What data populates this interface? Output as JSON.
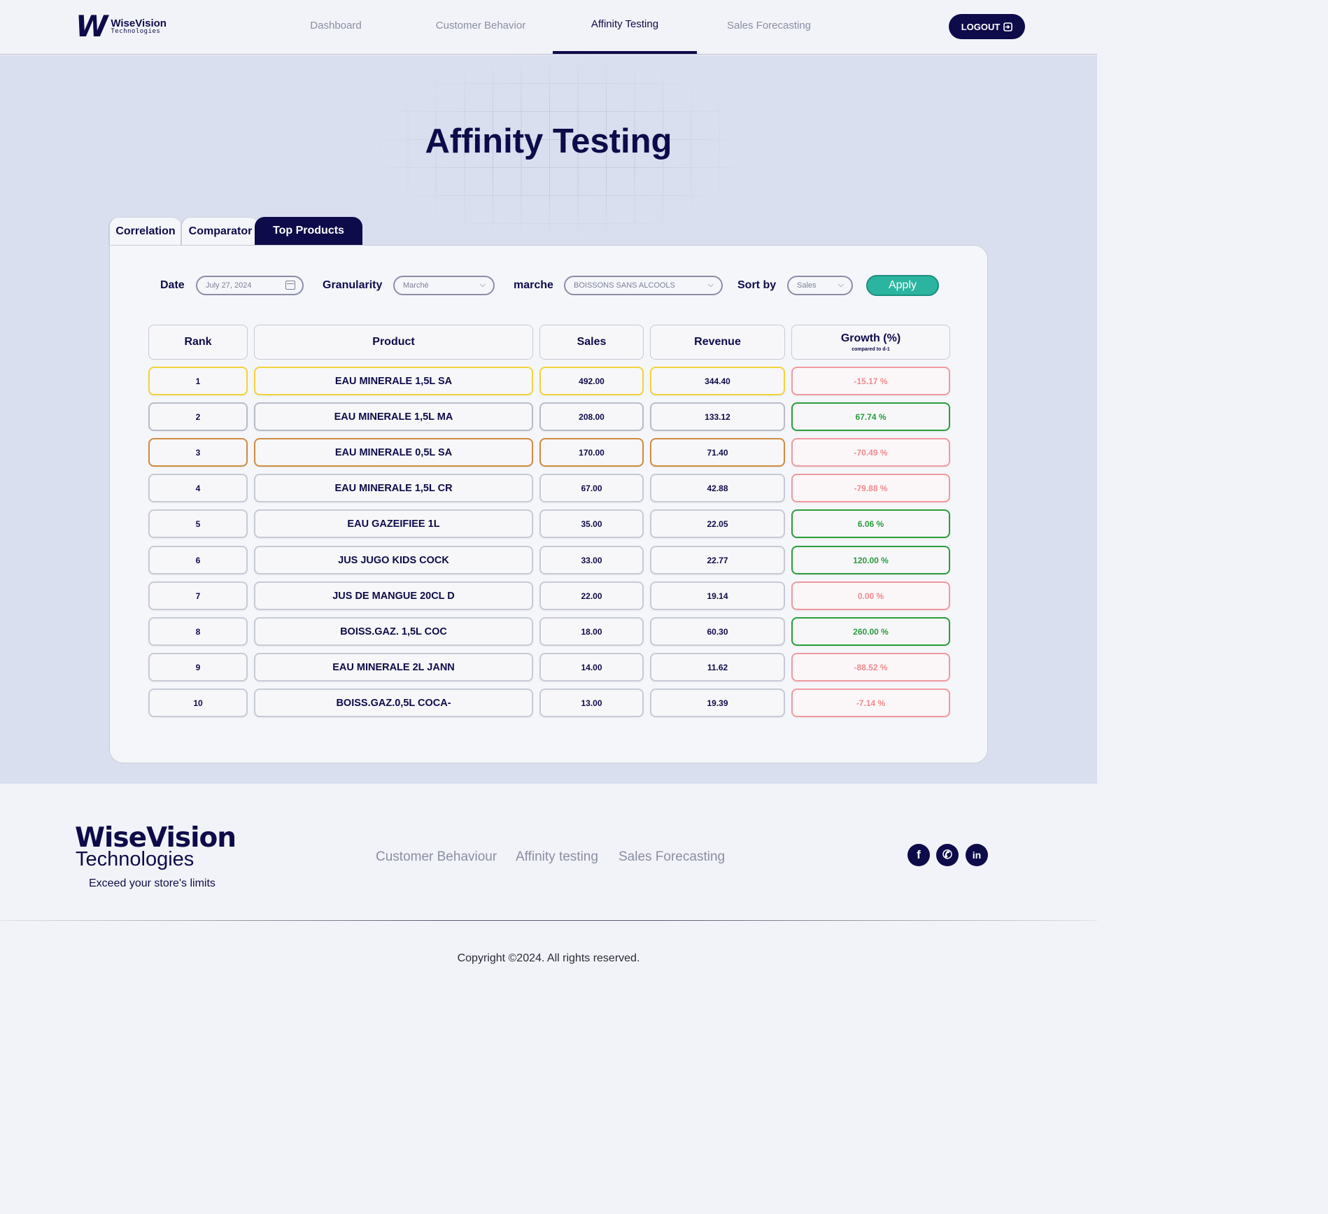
{
  "brand": {
    "name": "WiseVision",
    "sub": "Technologies",
    "mark": "W"
  },
  "nav": {
    "items": [
      "Dashboard",
      "Customer Behavior",
      "Affinity Testing",
      "Sales Forecasting"
    ],
    "active": "Affinity Testing",
    "logout_label": "LOGOUT",
    "logout_icon": "exit-icon"
  },
  "page": {
    "title": "Affinity Testing"
  },
  "tabs": [
    {
      "label": "Correlation",
      "active": false
    },
    {
      "label": "Comparator",
      "active": false
    },
    {
      "label": "Top Products",
      "active": true
    }
  ],
  "filters": {
    "date_label": "Date",
    "date_value": "July 27, 2024",
    "granularity_label": "Granularity",
    "granularity_value": "Marché",
    "marche_label": "marche",
    "marche_value": "BOISSONS SANS ALCOOLS",
    "sort_label": "Sort by",
    "sort_value": "Sales",
    "apply_label": "Apply"
  },
  "table": {
    "headers": {
      "rank": "Rank",
      "product": "Product",
      "sales": "Sales",
      "revenue": "Revenue",
      "growth": "Growth (%)",
      "growth_sub": "compared to d-1"
    },
    "rows": [
      {
        "rank": "1",
        "product": "EAU MINERALE 1,5L SA",
        "sales": "492.00",
        "revenue": "344.40",
        "growth": "-15.17 %",
        "trend": "neg",
        "medal": "gold"
      },
      {
        "rank": "2",
        "product": "EAU MINERALE 1,5L MA",
        "sales": "208.00",
        "revenue": "133.12",
        "growth": "67.74 %",
        "trend": "pos",
        "medal": "silver"
      },
      {
        "rank": "3",
        "product": "EAU MINERALE 0,5L SA",
        "sales": "170.00",
        "revenue": "71.40",
        "growth": "-70.49 %",
        "trend": "neg",
        "medal": "bronze"
      },
      {
        "rank": "4",
        "product": "EAU MINERALE 1,5L CR",
        "sales": "67.00",
        "revenue": "42.88",
        "growth": "-79.88 %",
        "trend": "neg",
        "medal": ""
      },
      {
        "rank": "5",
        "product": "EAU GAZEIFIEE 1L",
        "sales": "35.00",
        "revenue": "22.05",
        "growth": "6.06 %",
        "trend": "pos",
        "medal": ""
      },
      {
        "rank": "6",
        "product": "JUS JUGO KIDS COCK",
        "sales": "33.00",
        "revenue": "22.77",
        "growth": "120.00 %",
        "trend": "pos",
        "medal": ""
      },
      {
        "rank": "7",
        "product": "JUS DE MANGUE 20CL D",
        "sales": "22.00",
        "revenue": "19.14",
        "growth": "0.00 %",
        "trend": "neg",
        "medal": ""
      },
      {
        "rank": "8",
        "product": "BOISS.GAZ. 1,5L COC",
        "sales": "18.00",
        "revenue": "60.30",
        "growth": "260.00 %",
        "trend": "pos",
        "medal": ""
      },
      {
        "rank": "9",
        "product": "EAU MINERALE 2L JANN",
        "sales": "14.00",
        "revenue": "11.62",
        "growth": "-88.52 %",
        "trend": "neg",
        "medal": ""
      },
      {
        "rank": "10",
        "product": "BOISS.GAZ.0,5L COCA-",
        "sales": "13.00",
        "revenue": "19.39",
        "growth": "-7.14 %",
        "trend": "neg",
        "medal": ""
      }
    ]
  },
  "footer": {
    "brand_line1": "WiseVision",
    "brand_line2": "Technologies",
    "tagline": "Exceed your store's limits",
    "links": [
      "Customer Behaviour",
      "Affinity testing",
      "Sales Forecasting"
    ],
    "social": [
      {
        "icon": "facebook-icon",
        "glyph": "f"
      },
      {
        "icon": "whatsapp-icon",
        "glyph": "✆"
      },
      {
        "icon": "linkedin-icon",
        "glyph": "in"
      }
    ],
    "copyright": "Copyright ©2024. All rights reserved."
  },
  "colors": {
    "primary": "#0e0b4a",
    "accent": "#2bb5a0",
    "gold": "#f2d33a",
    "silver": "#b9bcc8",
    "bronze": "#cf8b40",
    "positive": "#2a9d3c",
    "negative": "#f08a8e"
  }
}
